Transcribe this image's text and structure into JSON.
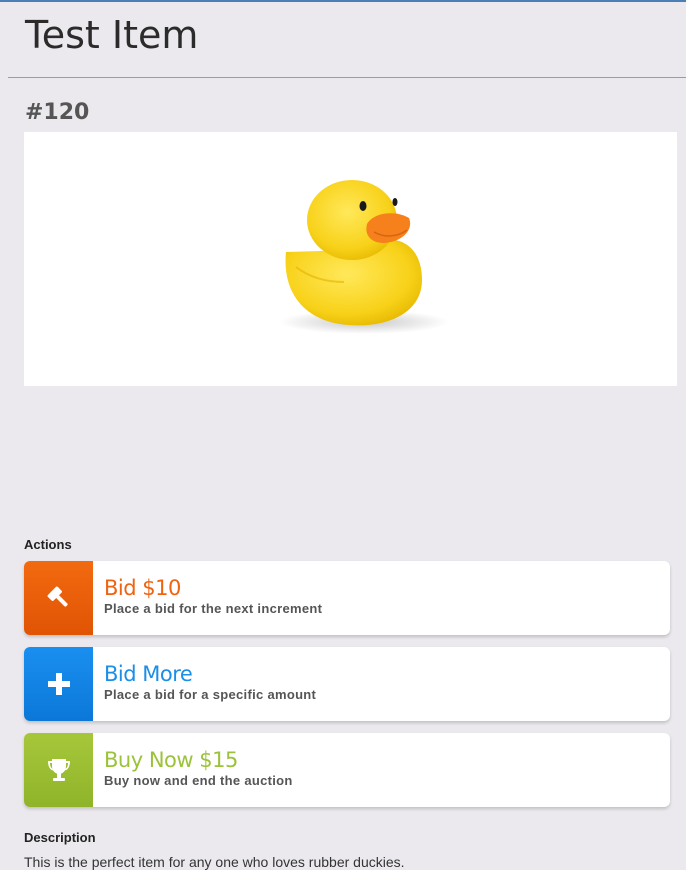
{
  "item": {
    "title": "Test Item",
    "number": "#120"
  },
  "actions": {
    "label": "Actions",
    "items": [
      {
        "title": "Bid $10",
        "subtitle": "Place a bid for the next increment",
        "icon": "gavel-icon",
        "color": "#ee6411"
      },
      {
        "title": "Bid More",
        "subtitle": "Place a bid for a specific amount",
        "icon": "plus-icon",
        "color": "#1b8fe8"
      },
      {
        "title": "Buy Now $15",
        "subtitle": "Buy now and end the auction",
        "icon": "trophy-icon",
        "color": "#9cc23a"
      }
    ]
  },
  "description": {
    "label": "Description",
    "text": "This is the perfect item for any one who loves rubber duckies."
  },
  "colors": {
    "background": "#ebe9ee",
    "accent_bar": "#4a7fb5"
  }
}
